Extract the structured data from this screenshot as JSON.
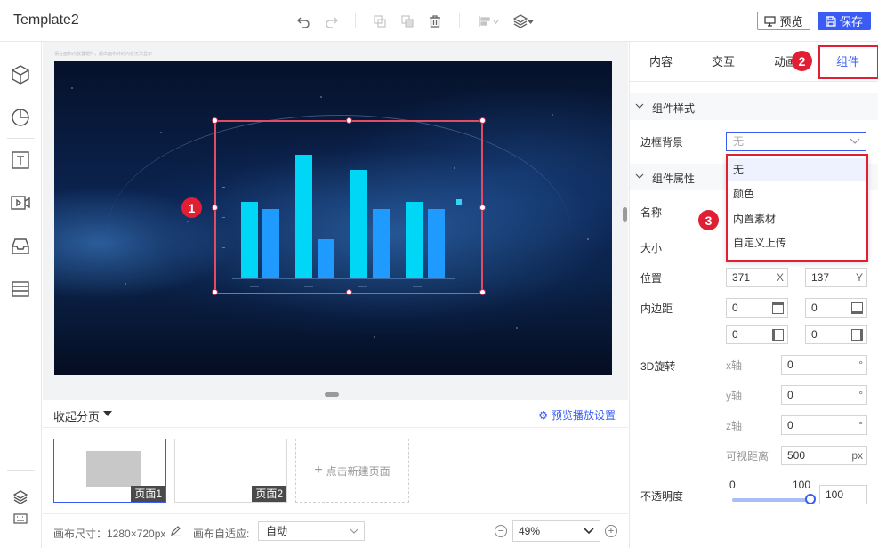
{
  "app": {
    "title": "Template2"
  },
  "toolbar": {
    "preview_label": "预览",
    "save_label": "保存"
  },
  "left_rail": {
    "items": [
      "cube-icon",
      "pie-icon",
      "text-icon",
      "video-icon",
      "inbox-icon",
      "list-icon",
      "layers-icon",
      "keyboard-icon"
    ]
  },
  "canvas": {
    "hint": "请在画布内放置组件，超出画布外的内容无法显示"
  },
  "chart_data": {
    "type": "bar",
    "values": [
      85,
      77,
      138,
      43,
      121,
      77,
      85,
      77
    ],
    "colors": [
      "#00d6f6",
      "#1f9bff"
    ]
  },
  "badges": {
    "b1": "1",
    "b2": "2",
    "b3": "3"
  },
  "pages": {
    "collapse_label": "收起分页",
    "preview_setting": "预览播放设置",
    "items": [
      {
        "label": "页面1"
      },
      {
        "label": "页面2"
      }
    ],
    "new_page": "点击新建页面"
  },
  "footer": {
    "canvas_size": "画布尺寸：1280×720px",
    "fit_label": "画布自适应:",
    "fit_value": "自动",
    "zoom": "49%"
  },
  "right_panel": {
    "tabs": [
      {
        "label": "内容"
      },
      {
        "label": "交互"
      },
      {
        "label": "动画"
      },
      {
        "label": "组件"
      }
    ],
    "style_section": "组件样式",
    "border_bg_label": "边框背景",
    "border_bg_value": "无",
    "dropdown_options": [
      "无",
      "颜色",
      "内置素材",
      "自定义上传"
    ],
    "props_section": "组件属性",
    "name_label": "名称",
    "size_label": "大小",
    "position_label": "位置",
    "pos_x": "371",
    "pos_x_unit": "X",
    "pos_y": "137",
    "pos_y_unit": "Y",
    "padding_label": "内边距",
    "padding": [
      "0",
      "0",
      "0",
      "0"
    ],
    "rotate_label": "3D旋转",
    "x_axis": "x轴",
    "y_axis": "y轴",
    "z_axis": "z轴",
    "rot_x": "0",
    "rot_y": "0",
    "rot_z": "0",
    "deg": "°",
    "view_dist_label": "可视距离",
    "view_dist": "500",
    "px_unit": "px",
    "opacity_label": "不透明度",
    "opacity_min": "0",
    "opacity_max": "100",
    "opacity_value": "100"
  }
}
